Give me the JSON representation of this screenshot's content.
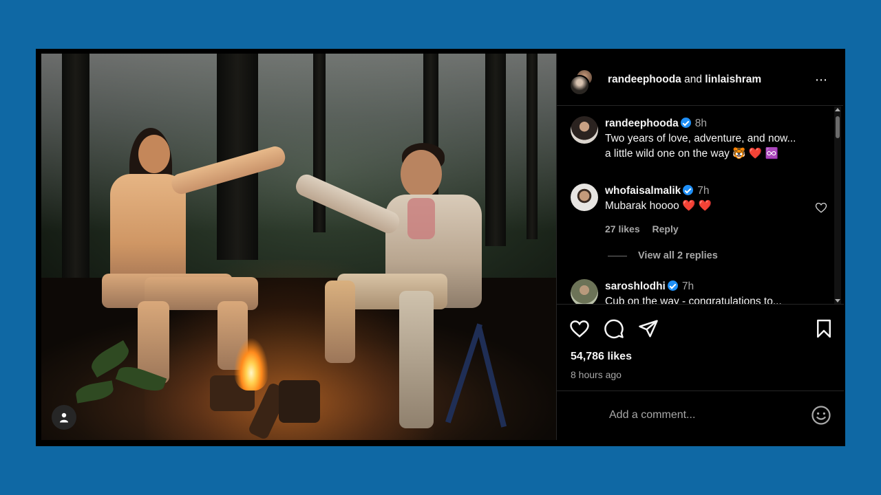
{
  "post": {
    "header": {
      "author": "randeephooda",
      "joiner": "and",
      "collaborator": "linlaishram",
      "more_icon": "⋯"
    },
    "caption": {
      "username": "randeephooda",
      "time": "8h",
      "line1": "Two years of love, adventure, and now...",
      "line2": "a little wild one on the way 🐯 ❤️ ♾️"
    },
    "comments": [
      {
        "username": "whofaisalmalik",
        "time": "7h",
        "text": "Mubarak hoooo ❤️ ❤️",
        "likes": "27 likes",
        "reply": "Reply",
        "view_replies": "View all 2 replies"
      },
      {
        "username": "saroshlodhi",
        "time": "7h",
        "text": "Cub on the way - congratulations to..."
      }
    ],
    "likes": "54,786 likes",
    "posted_ago": "8 hours ago",
    "add_comment_placeholder": "Add a comment..."
  },
  "icons": {
    "like": "heart-icon",
    "comment": "comment-icon",
    "share": "share-icon",
    "save": "bookmark-icon",
    "emoji": "emoji-icon",
    "tagged_user": "user-icon"
  },
  "colors": {
    "page_background": "#0f68a4",
    "panel_background": "#000000",
    "verified_blue": "#1f8ff6",
    "secondary_text": "#a8a8a8"
  }
}
